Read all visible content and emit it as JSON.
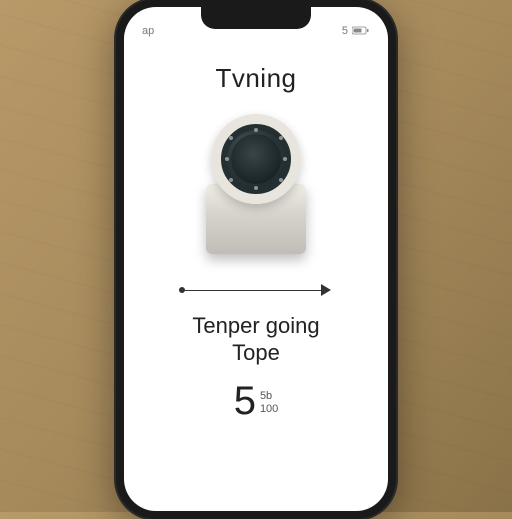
{
  "status_bar": {
    "left_indicator": "ap",
    "right_indicator": "5"
  },
  "content": {
    "title": "Tvning",
    "subtitle_line1": "Tenper going",
    "subtitle_line2": "Tope",
    "big_number": "5",
    "small_top": "5b",
    "small_bottom": "100"
  }
}
